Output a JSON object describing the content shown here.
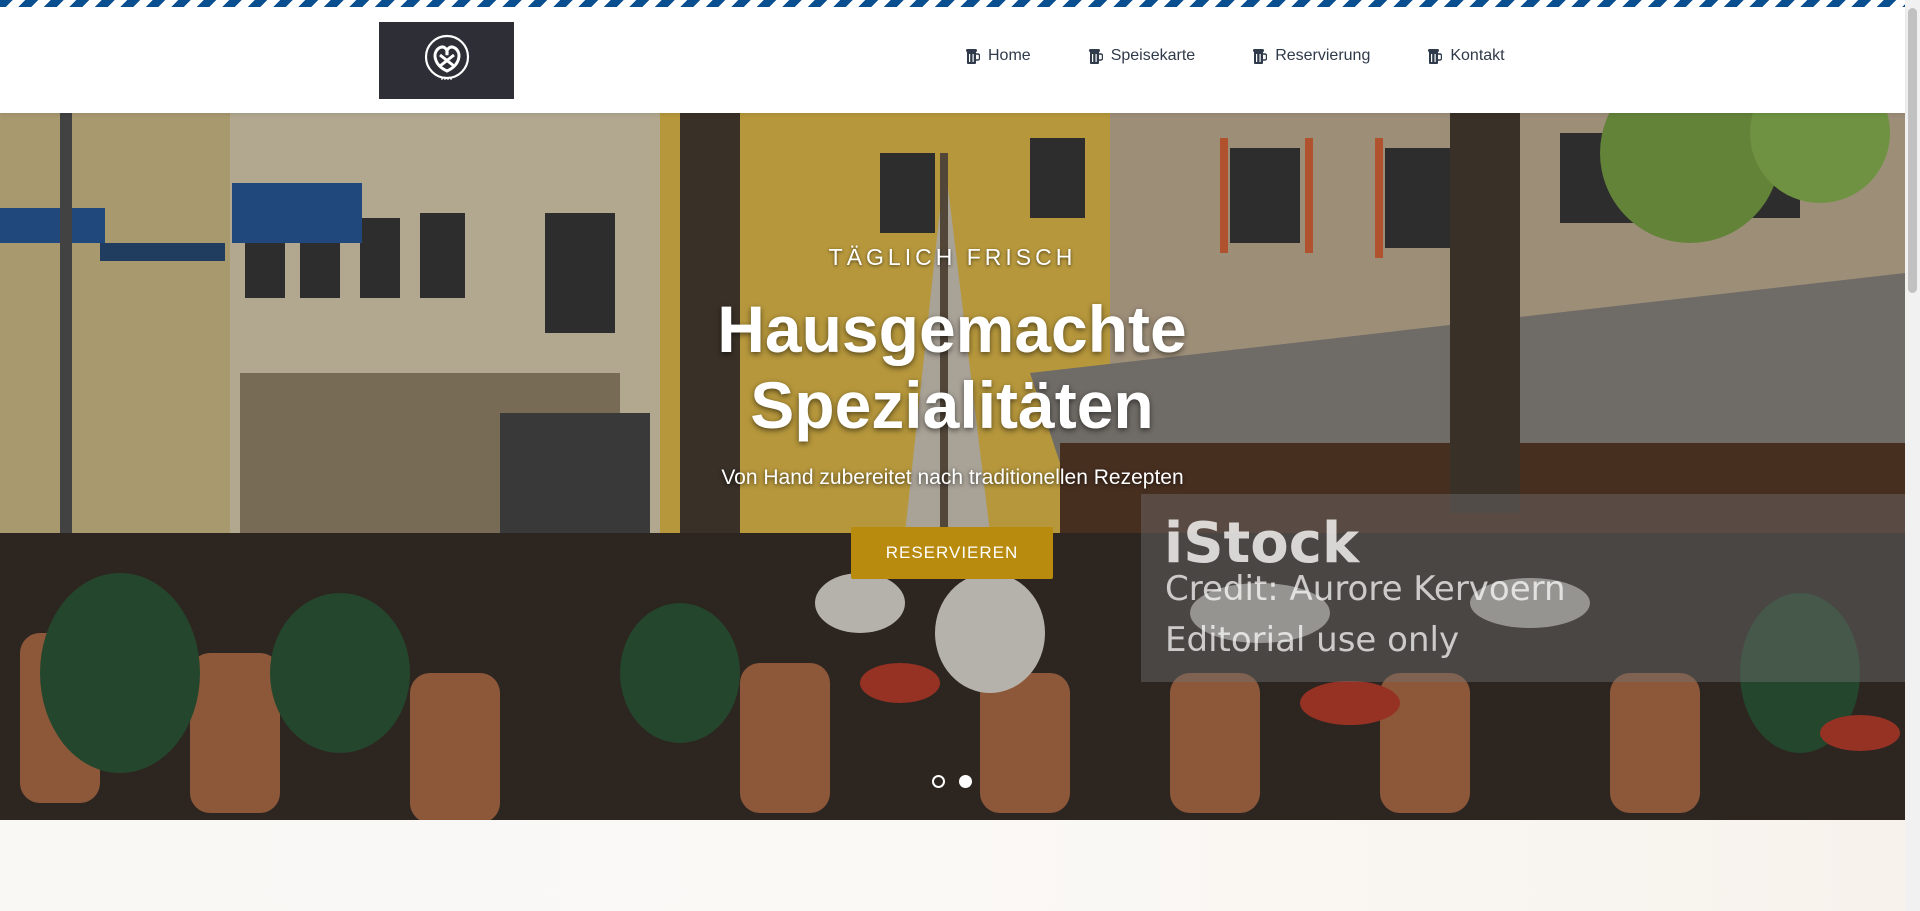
{
  "nav": {
    "logo_icon": "pretzel-icon",
    "items": [
      {
        "label": "Home",
        "icon": "beer-mug-icon"
      },
      {
        "label": "Speisekarte",
        "icon": "beer-mug-icon"
      },
      {
        "label": "Reservierung",
        "icon": "beer-mug-icon"
      },
      {
        "label": "Kontakt",
        "icon": "beer-mug-icon"
      }
    ]
  },
  "hero": {
    "kicker": "TÄGLICH FRISCH",
    "title": "Hausgemachte Spezialitäten",
    "subtitle": "Von Hand zubereitet nach traditionellen Rezepten",
    "button_label": "RESERVIEREN",
    "slide_count": 2,
    "active_slide": 2,
    "watermark": {
      "brand": "iStock",
      "credit": "Credit: Aurore Kervoern",
      "usage": "Editorial use only"
    }
  },
  "colors": {
    "accent": "#b88a0d",
    "stripe": "#0a4f8f",
    "logo_bg": "#2d2e36",
    "nav_text": "#2f3a4a"
  }
}
